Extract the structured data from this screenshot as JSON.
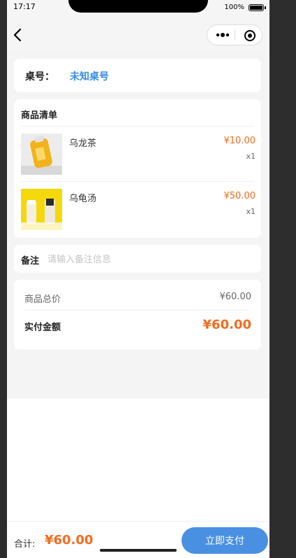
{
  "status_bar": {
    "time": "17:17",
    "battery_text": "100%"
  },
  "nav": {
    "back_icon": "chevron-left-icon",
    "more_icon": "more-dots-icon",
    "close_icon": "target-circle-icon"
  },
  "table_info": {
    "label": "桌号：",
    "value": "未知桌号"
  },
  "goods": {
    "title": "商品清单",
    "items": [
      {
        "name": "乌龙茶",
        "price": "¥10.00",
        "qty": "x1",
        "image": "oolong-tea-bottle"
      },
      {
        "name": "乌龟汤",
        "price": "¥50.00",
        "qty": "x1",
        "image": "turtle-soup-drinks"
      }
    ]
  },
  "remark": {
    "label": "备注",
    "placeholder": "请输入备注信息",
    "value": ""
  },
  "summary": {
    "subtotal_label": "商品总价",
    "subtotal_value": "¥60.00",
    "paid_label": "实付金额",
    "paid_value": "¥60.00"
  },
  "bottom_bar": {
    "total_label": "合计:",
    "total_value": "¥60.00",
    "pay_button": "立即支付"
  },
  "colors": {
    "accent_orange": "#f26b1d",
    "accent_blue": "#4a90e2",
    "table_value_blue": "#3a8ee6",
    "page_bg": "#f4f4f4"
  }
}
